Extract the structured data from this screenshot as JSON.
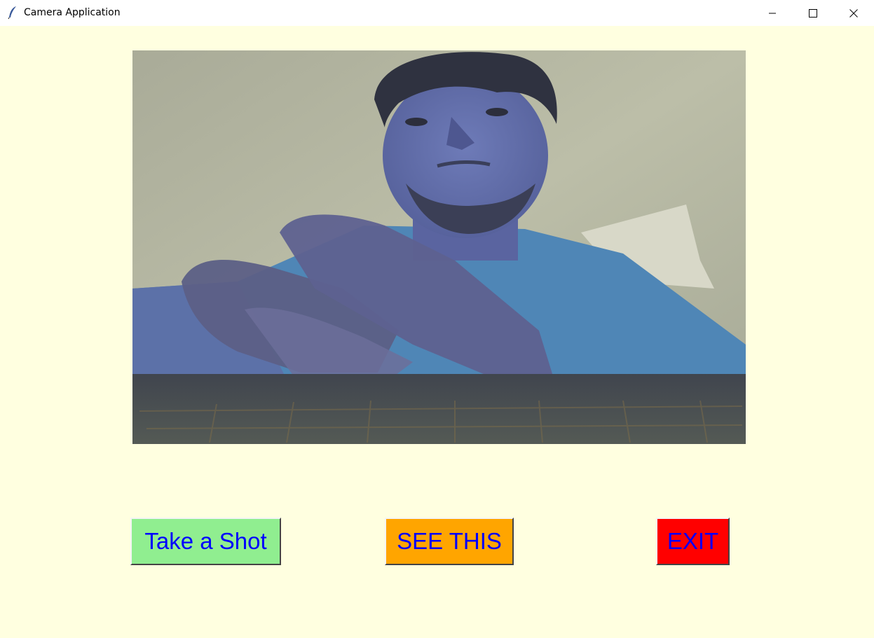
{
  "window": {
    "title": "Camera Application",
    "icon": "feather-icon",
    "controls": [
      "minimize-icon",
      "maximize-icon",
      "close-icon"
    ],
    "background_color": "#ffffe0"
  },
  "camera": {
    "content": "live webcam feed",
    "tint": "blue"
  },
  "buttons": {
    "take_shot": {
      "label": "Take a Shot",
      "bg": "#90ee90",
      "fg": "#0000ff"
    },
    "see_this": {
      "label": "SEE THIS",
      "bg": "#ffa500",
      "fg": "#0000ff"
    },
    "exit": {
      "label": "EXIT",
      "bg": "#ff0000",
      "fg": "#0000ff"
    }
  }
}
